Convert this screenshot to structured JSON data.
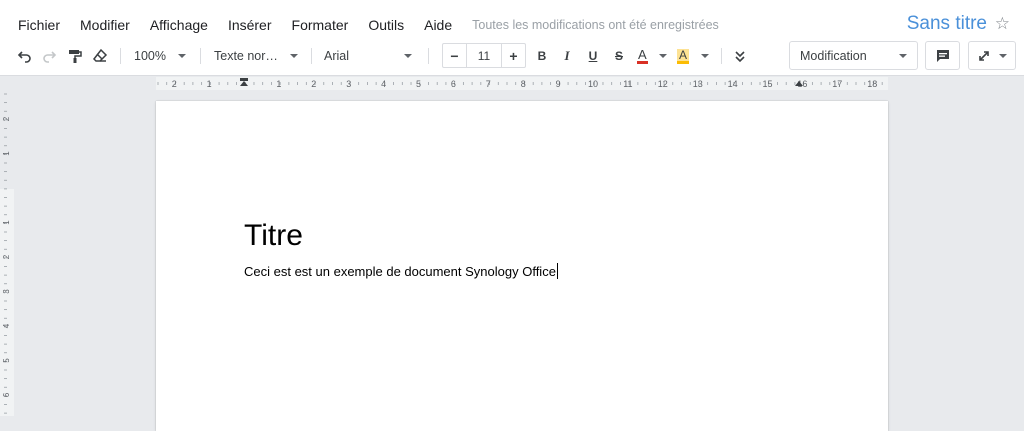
{
  "menubar": {
    "items": [
      "Fichier",
      "Modifier",
      "Affichage",
      "Insérer",
      "Formater",
      "Outils",
      "Aide"
    ],
    "save_status": "Toutes les modifications ont été enregistrées"
  },
  "document": {
    "title": "Sans titre",
    "heading": "Titre",
    "body": "Ceci est est un exemple de document Synology Office"
  },
  "toolbar": {
    "zoom": "100%",
    "style": "Texte nor…",
    "font": "Arial",
    "font_size": "11",
    "mode": "Modification",
    "bold_label": "B",
    "italic_label": "I",
    "underline_label": "U",
    "strike_label": "S",
    "text_color_label": "A",
    "highlight_label": "A",
    "minus_label": "−",
    "plus_label": "+"
  },
  "ruler": {
    "labels": [
      "2",
      "1",
      "1",
      "2",
      "3",
      "4",
      "5",
      "6",
      "7",
      "8",
      "9",
      "10",
      "11",
      "12",
      "13",
      "14",
      "15",
      "16",
      "17",
      "18"
    ]
  },
  "vertical_ruler": {
    "labels": [
      "2",
      "1",
      "1",
      "2",
      "3",
      "4",
      "5",
      "6"
    ]
  },
  "colors": {
    "accent": "#4a90d9",
    "text_color_underline": "#d93025",
    "highlight_underline": "#fbbc04"
  }
}
